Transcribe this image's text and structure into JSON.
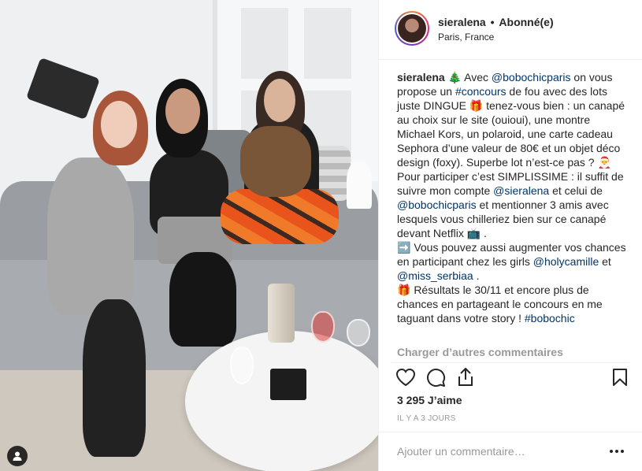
{
  "post_header": {
    "username": "sieralena",
    "separator": "•",
    "follow_status": "Abonné(e)",
    "location": "Paris, France",
    "avatar_icon": "profile-avatar"
  },
  "caption": {
    "username": "sieralena",
    "parts": {
      "p1a": "🎄 Avec ",
      "m1": "@bobochicparis",
      "p1b": " on vous propose un ",
      "h1": "#concours",
      "p1c": " de fou avec des lots juste DINGUE 🎁 tenez-vous bien : un canapé au choix sur le site (ouioui), une montre Michael Kors, un polaroid, une carte cadeau Sephora d’une valeur de 80€ et un objet déco design (foxy). Superbe lot n’est-ce pas ? 🎅",
      "p2a": "Pour participer c’est SIMPLISSIME : il suffit de suivre mon compte ",
      "m2": "@sieralena",
      "p2b": " et celui de ",
      "m3": "@bobochicparis",
      "p2c": " et mentionner 3 amis avec lesquels vous chilleriez bien sur ce canapé devant Netflix 📺 .",
      "p3a": "➡️ Vous pouvez aussi augmenter vos chances en participant chez les girls ",
      "m4": "@holycamille",
      "p3b": " et ",
      "m5": "@miss_serbiaa",
      "p3c": " .",
      "p4a": "🎁 Résultats le 30/11 et encore plus de chances en partageant le concours en me taguant dans votre story ! ",
      "h2": "#bobochic"
    }
  },
  "load_more_comments": "Charger d’autres commentaires",
  "actions": {
    "like_icon": "heart-icon",
    "comment_icon": "comment-icon",
    "share_icon": "share-icon",
    "save_icon": "bookmark-icon"
  },
  "likes": "3 295 J’aime",
  "timestamp": "IL Y A 3 JOURS",
  "comment_box": {
    "placeholder": "Ajouter un commentaire…",
    "more_icon": "ellipsis-icon"
  },
  "photo": {
    "user_tag_icon": "person-tag-icon"
  },
  "colors": {
    "link": "#003569",
    "muted": "#999999",
    "text": "#262626",
    "divider": "#efefef"
  }
}
